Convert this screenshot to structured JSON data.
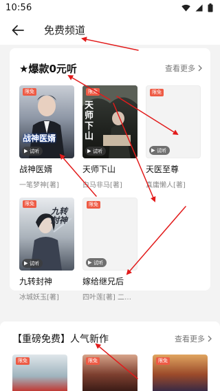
{
  "status_bar": {
    "time": "10:56"
  },
  "app_bar": {
    "title": "免费频道"
  },
  "free_section": {
    "title": "★爆款0元听",
    "more": "查看更多",
    "books": [
      {
        "title": "战神医婿",
        "author": "一笔梦神[著]",
        "tag": "限免",
        "listen": "试听",
        "cover_text": "战神医婿"
      },
      {
        "title": "天师下山",
        "author": "白马非马[著]",
        "tag": "限免",
        "listen": "试听",
        "cover_text": "天师下山"
      },
      {
        "title": "天医至尊",
        "author": "真庸懒人[著]",
        "tag": "限免",
        "listen": "试听"
      },
      {
        "title": "九转封神",
        "author": "冰城妖玉[著]",
        "tag": "限免",
        "listen": "试听",
        "cover_text": "九转封神"
      },
      {
        "title": "嫁给继兄后",
        "author": "四叶莲[著] 二…",
        "tag": "限免",
        "listen": "试听"
      }
    ]
  },
  "popular_section": {
    "title": "【重磅免费】人气新作",
    "more": "查看更多",
    "thumbs": [
      {
        "tag": "限免"
      },
      {
        "tag": "限免"
      },
      {
        "tag": "限免"
      }
    ]
  }
}
